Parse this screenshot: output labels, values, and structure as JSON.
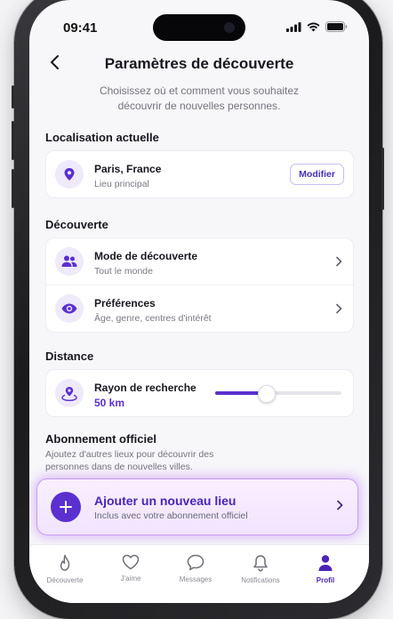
{
  "status_bar": {
    "time": "09:41"
  },
  "header": {
    "title": "Paramètres de découverte"
  },
  "intro": {
    "line1": "Choisissez où et comment vous souhaitez",
    "line2": "découvrir de nouvelles personnes."
  },
  "location": {
    "section_title": "Localisation actuelle",
    "city": "Paris, France",
    "subtitle": "Lieu principal",
    "modify_label": "Modifier"
  },
  "discovery": {
    "section_title": "Découverte",
    "items": [
      {
        "title": "Mode de découverte",
        "subtitle": "Tout le monde",
        "icon": "people-icon"
      },
      {
        "title": "Préférences",
        "subtitle": "Âge, genre, centres d'intérêt",
        "icon": "eye-icon"
      }
    ]
  },
  "distance": {
    "section_title": "Distance",
    "label": "Rayon de recherche",
    "value": "50 km",
    "slider_fraction": 0.4
  },
  "subscription": {
    "section_title": "Abonnement officiel",
    "description_line1": "Ajoutez d'autres lieux pour découvrir des",
    "description_line2": "personnes dans de nouvelles villes.",
    "add_title": "Ajouter un nouveau lieu",
    "add_subtitle": "Inclus avec votre abonnement officiel"
  },
  "tabbar": {
    "tabs": [
      {
        "label": "Découverte",
        "icon": "flame-icon"
      },
      {
        "label": "J'aime",
        "icon": "heart-icon"
      },
      {
        "label": "Messages",
        "icon": "chat-bubble-icon"
      },
      {
        "label": "Notifications",
        "icon": "bell-icon"
      },
      {
        "label": "Profil",
        "icon": "profile-icon",
        "active": true
      }
    ]
  },
  "colors": {
    "accent": "#5b2fd0",
    "accent_soft": "#efeaf9",
    "glow": "#c79bf4"
  }
}
